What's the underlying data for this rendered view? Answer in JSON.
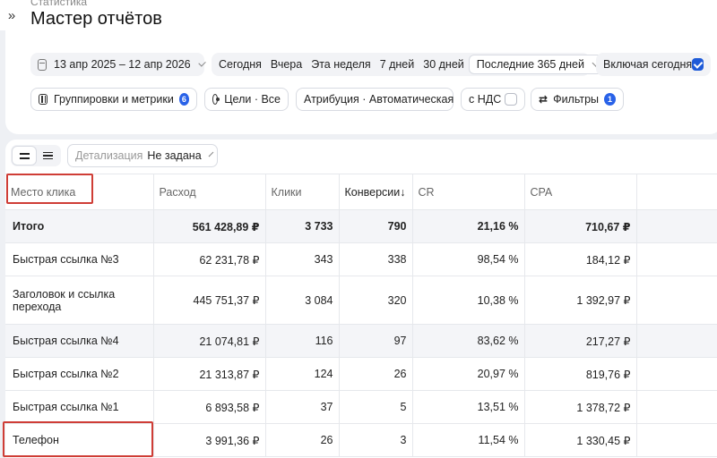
{
  "breadcrumb": "Статистика",
  "title": "Мастер отчётов",
  "date_range": "13 апр 2025 – 12 апр 2026",
  "periods": [
    {
      "label": "Сегодня",
      "active": false
    },
    {
      "label": "Вчера",
      "active": false
    },
    {
      "label": "Эта неделя",
      "active": false
    },
    {
      "label": "7 дней",
      "active": false
    },
    {
      "label": "30 дней",
      "active": false
    },
    {
      "label": "Последние 365 дней",
      "active": true
    }
  ],
  "include_today": {
    "label": "Включая сегодня",
    "checked": true
  },
  "filters_row": {
    "groupings": {
      "label": "Группировки и метрики",
      "badge": "6"
    },
    "goals": "Цели · Все",
    "attribution": "Атрибуция · Автоматическая",
    "vat": {
      "label": "с НДС",
      "checked": false
    },
    "filters": {
      "label": "Фильтры",
      "badge": "1"
    }
  },
  "detail": {
    "label": "Детализация",
    "value": "Не задана"
  },
  "table": {
    "headers": [
      "Место клика",
      "Расход",
      "Клики",
      "Конверсии↓",
      "CR",
      "CPA"
    ],
    "total": [
      "Итого",
      "561 428,89 ₽",
      "3 733",
      "790",
      "21,16 %",
      "710,67 ₽"
    ],
    "rows": [
      [
        "Быстрая ссылка №3",
        "62 231,78 ₽",
        "343",
        "338",
        "98,54 %",
        "184,12 ₽"
      ],
      [
        "Заголовок и ссылка перехода",
        "445 751,37 ₽",
        "3 084",
        "320",
        "10,38 %",
        "1 392,97 ₽"
      ],
      [
        "Быстрая ссылка №4",
        "21 074,81 ₽",
        "116",
        "97",
        "83,62 %",
        "217,27 ₽"
      ],
      [
        "Быстрая ссылка №2",
        "21 313,87 ₽",
        "124",
        "26",
        "20,97 %",
        "819,76 ₽"
      ],
      [
        "Быстрая ссылка №1",
        "6 893,58 ₽",
        "37",
        "5",
        "13,51 %",
        "1 378,72 ₽"
      ],
      [
        "Телефон",
        "3 991,36 ₽",
        "26",
        "3",
        "11,54 %",
        "1 330,45 ₽"
      ]
    ]
  },
  "colors": {
    "accent": "#2962e8",
    "highlight": "#cf3d36"
  }
}
